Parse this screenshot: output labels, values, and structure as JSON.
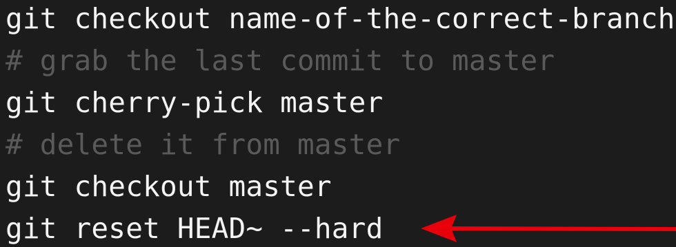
{
  "lines": [
    {
      "text": "git checkout name-of-the-correct-branch",
      "kind": "command"
    },
    {
      "text": "# grab the last commit to master",
      "kind": "comment"
    },
    {
      "text": "git cherry-pick master",
      "kind": "command"
    },
    {
      "text": "# delete it from master",
      "kind": "comment"
    },
    {
      "text": "git checkout master",
      "kind": "command"
    },
    {
      "text": "git reset HEAD~ --hard",
      "kind": "command"
    }
  ],
  "colors": {
    "background": "#1c1c1c",
    "command": "#f4f4f4",
    "comment": "#5a5a5a",
    "arrow": "#e8000b"
  },
  "annotation": {
    "icon": "left-arrow-icon",
    "points_to_line": 6
  }
}
